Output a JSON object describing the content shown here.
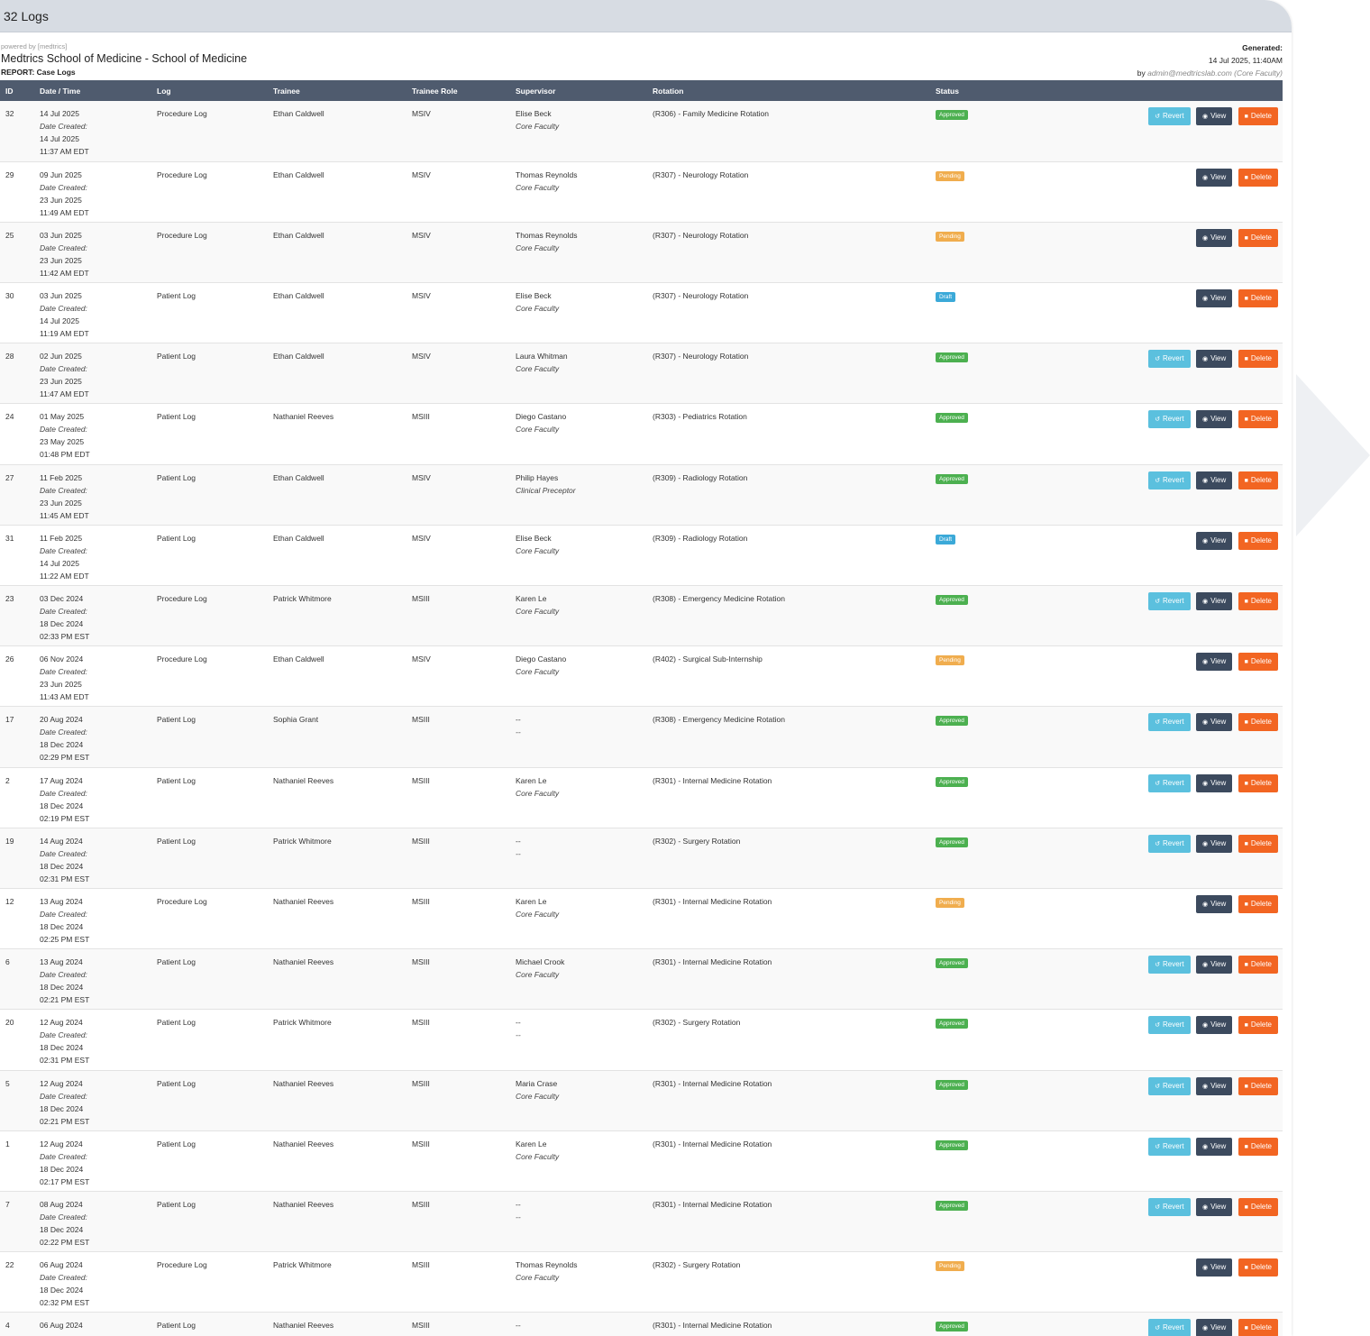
{
  "topbar": {
    "title": "32 Logs"
  },
  "report": {
    "powered_by": "powered by [medtrics]",
    "school": "Medtrics School of Medicine - School of Medicine",
    "report_label": "REPORT: Case Logs",
    "generated_label": "Generated:",
    "generated_value": "14 Jul 2025, 11:40AM",
    "by_prefix": "by",
    "by_user": "admin@medtricslab.com (Core Faculty)"
  },
  "table": {
    "columns": [
      "ID",
      "Date / Time",
      "Log",
      "Trainee",
      "Trainee Role",
      "Supervisor",
      "Rotation",
      "Status",
      ""
    ],
    "date_created_label": "Date Created:",
    "button_labels": {
      "revert": "Revert",
      "view": "View",
      "delete": "Delete"
    },
    "rows": [
      {
        "id": "32",
        "date": "14 Jul 2025",
        "created_date": "14 Jul 2025",
        "created_time": "11:37 AM EDT",
        "log": "Procedure Log",
        "trainee": "Ethan Caldwell",
        "role": "MSIV",
        "supervisor": "Elise Beck",
        "supervisor_role": "Core Faculty",
        "rotation": "(R306) - Family Medicine Rotation",
        "status": "Approved"
      },
      {
        "id": "29",
        "date": "09 Jun 2025",
        "created_date": "23 Jun 2025",
        "created_time": "11:49 AM EDT",
        "log": "Procedure Log",
        "trainee": "Ethan Caldwell",
        "role": "MSIV",
        "supervisor": "Thomas Reynolds",
        "supervisor_role": "Core Faculty",
        "rotation": "(R307) - Neurology Rotation",
        "status": "Pending"
      },
      {
        "id": "25",
        "date": "03 Jun 2025",
        "created_date": "23 Jun 2025",
        "created_time": "11:42 AM EDT",
        "log": "Procedure Log",
        "trainee": "Ethan Caldwell",
        "role": "MSIV",
        "supervisor": "Thomas Reynolds",
        "supervisor_role": "Core Faculty",
        "rotation": "(R307) - Neurology Rotation",
        "status": "Pending"
      },
      {
        "id": "30",
        "date": "03 Jun 2025",
        "created_date": "14 Jul 2025",
        "created_time": "11:19 AM EDT",
        "log": "Patient Log",
        "trainee": "Ethan Caldwell",
        "role": "MSIV",
        "supervisor": "Elise Beck",
        "supervisor_role": "Core Faculty",
        "rotation": "(R307) - Neurology Rotation",
        "status": "Draft"
      },
      {
        "id": "28",
        "date": "02 Jun 2025",
        "created_date": "23 Jun 2025",
        "created_time": "11:47 AM EDT",
        "log": "Patient Log",
        "trainee": "Ethan Caldwell",
        "role": "MSIV",
        "supervisor": "Laura Whitman",
        "supervisor_role": "Core Faculty",
        "rotation": "(R307) - Neurology Rotation",
        "status": "Approved"
      },
      {
        "id": "24",
        "date": "01 May 2025",
        "created_date": "23 May 2025",
        "created_time": "01:48 PM EDT",
        "log": "Patient Log",
        "trainee": "Nathaniel Reeves",
        "role": "MSIII",
        "supervisor": "Diego Castano",
        "supervisor_role": "Core Faculty",
        "rotation": "(R303) - Pediatrics Rotation",
        "status": "Approved"
      },
      {
        "id": "27",
        "date": "11 Feb 2025",
        "created_date": "23 Jun 2025",
        "created_time": "11:45 AM EDT",
        "log": "Patient Log",
        "trainee": "Ethan Caldwell",
        "role": "MSIV",
        "supervisor": "Philip Hayes",
        "supervisor_role": "Clinical Preceptor",
        "rotation": "(R309) - Radiology Rotation",
        "status": "Approved"
      },
      {
        "id": "31",
        "date": "11 Feb 2025",
        "created_date": "14 Jul 2025",
        "created_time": "11:22 AM EDT",
        "log": "Patient Log",
        "trainee": "Ethan Caldwell",
        "role": "MSIV",
        "supervisor": "Elise Beck",
        "supervisor_role": "Core Faculty",
        "rotation": "(R309) - Radiology Rotation",
        "status": "Draft"
      },
      {
        "id": "23",
        "date": "03 Dec 2024",
        "created_date": "18 Dec 2024",
        "created_time": "02:33 PM EST",
        "log": "Procedure Log",
        "trainee": "Patrick Whitmore",
        "role": "MSIII",
        "supervisor": "Karen Le",
        "supervisor_role": "Core Faculty",
        "rotation": "(R308) - Emergency Medicine Rotation",
        "status": "Approved"
      },
      {
        "id": "26",
        "date": "06 Nov 2024",
        "created_date": "23 Jun 2025",
        "created_time": "11:43 AM EDT",
        "log": "Procedure Log",
        "trainee": "Ethan Caldwell",
        "role": "MSIV",
        "supervisor": "Diego Castano",
        "supervisor_role": "Core Faculty",
        "rotation": "(R402) - Surgical Sub-Internship",
        "status": "Pending"
      },
      {
        "id": "17",
        "date": "20 Aug 2024",
        "created_date": "18 Dec 2024",
        "created_time": "02:29 PM EST",
        "log": "Patient Log",
        "trainee": "Sophia Grant",
        "role": "MSIII",
        "supervisor": "--",
        "supervisor_role": "--",
        "rotation": "(R308) - Emergency Medicine Rotation",
        "status": "Approved"
      },
      {
        "id": "2",
        "date": "17 Aug 2024",
        "created_date": "18 Dec 2024",
        "created_time": "02:19 PM EST",
        "log": "Patient Log",
        "trainee": "Nathaniel Reeves",
        "role": "MSIII",
        "supervisor": "Karen Le",
        "supervisor_role": "Core Faculty",
        "rotation": "(R301) - Internal Medicine Rotation",
        "status": "Approved"
      },
      {
        "id": "19",
        "date": "14 Aug 2024",
        "created_date": "18 Dec 2024",
        "created_time": "02:31 PM EST",
        "log": "Patient Log",
        "trainee": "Patrick Whitmore",
        "role": "MSIII",
        "supervisor": "--",
        "supervisor_role": "--",
        "rotation": "(R302) - Surgery Rotation",
        "status": "Approved"
      },
      {
        "id": "12",
        "date": "13 Aug 2024",
        "created_date": "18 Dec 2024",
        "created_time": "02:25 PM EST",
        "log": "Procedure Log",
        "trainee": "Nathaniel Reeves",
        "role": "MSIII",
        "supervisor": "Karen Le",
        "supervisor_role": "Core Faculty",
        "rotation": "(R301) - Internal Medicine Rotation",
        "status": "Pending"
      },
      {
        "id": "6",
        "date": "13 Aug 2024",
        "created_date": "18 Dec 2024",
        "created_time": "02:21 PM EST",
        "log": "Patient Log",
        "trainee": "Nathaniel Reeves",
        "role": "MSIII",
        "supervisor": "Michael Crook",
        "supervisor_role": "Core Faculty",
        "rotation": "(R301) - Internal Medicine Rotation",
        "status": "Approved"
      },
      {
        "id": "20",
        "date": "12 Aug 2024",
        "created_date": "18 Dec 2024",
        "created_time": "02:31 PM EST",
        "log": "Patient Log",
        "trainee": "Patrick Whitmore",
        "role": "MSIII",
        "supervisor": "--",
        "supervisor_role": "--",
        "rotation": "(R302) - Surgery Rotation",
        "status": "Approved"
      },
      {
        "id": "5",
        "date": "12 Aug 2024",
        "created_date": "18 Dec 2024",
        "created_time": "02:21 PM EST",
        "log": "Patient Log",
        "trainee": "Nathaniel Reeves",
        "role": "MSIII",
        "supervisor": "Maria Crase",
        "supervisor_role": "Core Faculty",
        "rotation": "(R301) - Internal Medicine Rotation",
        "status": "Approved"
      },
      {
        "id": "1",
        "date": "12 Aug 2024",
        "created_date": "18 Dec 2024",
        "created_time": "02:17 PM EST",
        "log": "Patient Log",
        "trainee": "Nathaniel Reeves",
        "role": "MSIII",
        "supervisor": "Karen Le",
        "supervisor_role": "Core Faculty",
        "rotation": "(R301) - Internal Medicine Rotation",
        "status": "Approved"
      },
      {
        "id": "7",
        "date": "08 Aug 2024",
        "created_date": "18 Dec 2024",
        "created_time": "02:22 PM EST",
        "log": "Patient Log",
        "trainee": "Nathaniel Reeves",
        "role": "MSIII",
        "supervisor": "--",
        "supervisor_role": "--",
        "rotation": "(R301) - Internal Medicine Rotation",
        "status": "Approved"
      },
      {
        "id": "22",
        "date": "06 Aug 2024",
        "created_date": "18 Dec 2024",
        "created_time": "02:32 PM EST",
        "log": "Procedure Log",
        "trainee": "Patrick Whitmore",
        "role": "MSIII",
        "supervisor": "Thomas Reynolds",
        "supervisor_role": "Core Faculty",
        "rotation": "(R302) - Surgery Rotation",
        "status": "Pending"
      },
      {
        "id": "4",
        "date": "06 Aug 2024",
        "created_date": "",
        "created_time": "",
        "log": "Patient Log",
        "trainee": "Nathaniel Reeves",
        "role": "MSIII",
        "supervisor": "--",
        "supervisor_role": "",
        "rotation": "(R301) - Internal Medicine Rotation",
        "status": "Approved"
      }
    ]
  },
  "colors": {
    "header_bg": "#4f5b6e",
    "approved": "#4cb050",
    "pending": "#f0ad4e",
    "draft": "#3ba9d8",
    "revert": "#5bc0de",
    "view": "#3c4a5e",
    "delete": "#f26522"
  },
  "icons": {
    "revert": "undo-icon",
    "view": "eye-icon",
    "delete": "trash-icon"
  }
}
